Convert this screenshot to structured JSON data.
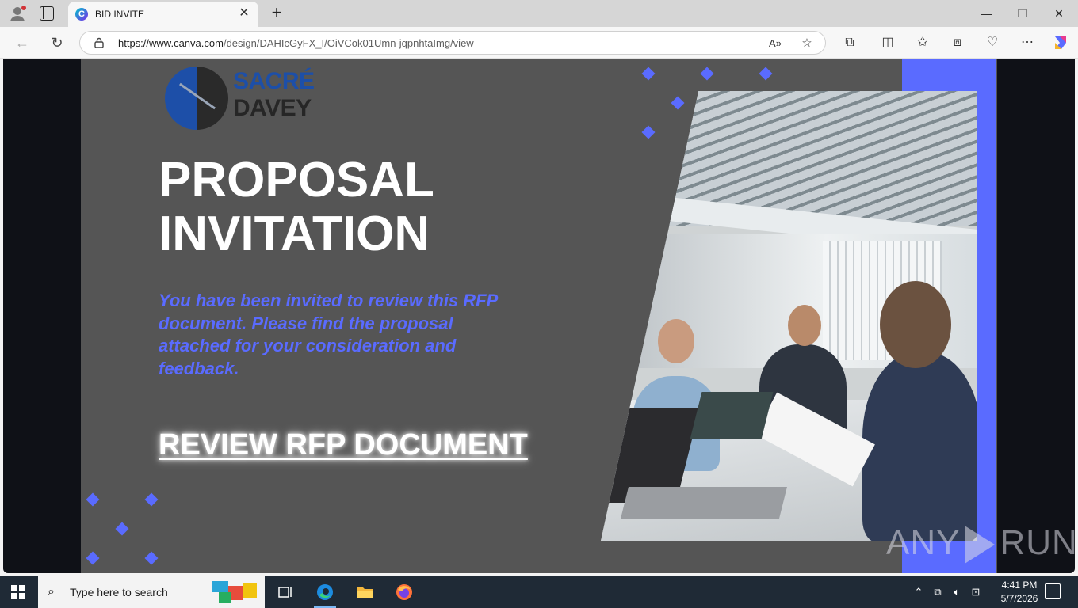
{
  "browser": {
    "tab_title": "BID INVITE",
    "tab_favicon": "canva-favicon",
    "new_tab_label": "+",
    "close_tab_label": "✕",
    "window_controls": {
      "minimize": "—",
      "restore": "❐",
      "close": "✕"
    },
    "url_host": "https://www.canva.com",
    "url_path": "/design/DAHIcGyFX_I/OiVCok01Umn-jqpnhtaImg/view"
  },
  "slide": {
    "logo": {
      "line1": "SACRÉ",
      "line2": "DAVEY"
    },
    "heading_line1": "PROPOSAL",
    "heading_line2": "INVITATION",
    "intro": "You have been invited to review this RFP document. Please find the proposal attached for your consideration and feedback.",
    "cta": "REVIEW RFP DOCUMENT",
    "colors": {
      "background": "#555555",
      "accent": "#5a6bff",
      "text": "#ffffff"
    }
  },
  "watermark": {
    "left": "ANY",
    "right": "RUN"
  },
  "taskbar": {
    "search_placeholder": "Type here to search",
    "apps": [
      "task-view",
      "edge",
      "file-explorer",
      "firefox"
    ],
    "clock_time": "4:41 PM",
    "clock_date": "5/7/2026"
  }
}
